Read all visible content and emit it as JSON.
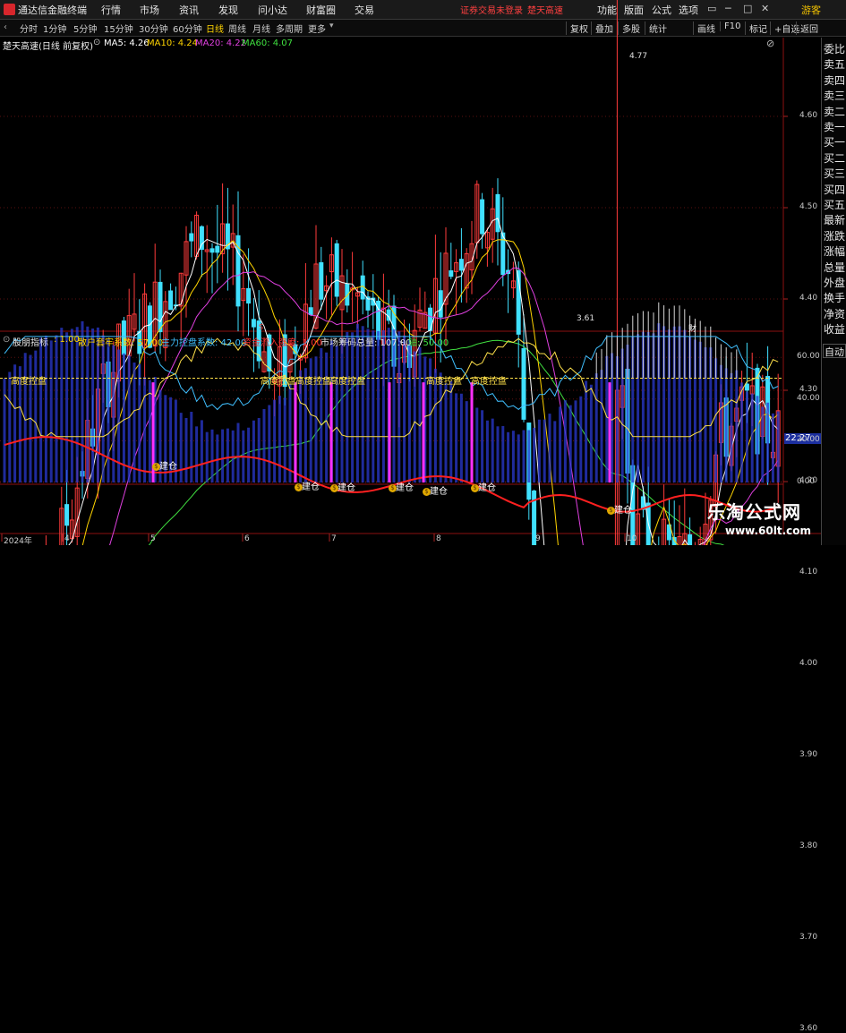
{
  "app": {
    "title": "通达信金融终端",
    "menu": [
      "行情",
      "市场",
      "资讯",
      "发现",
      "问小达",
      "财富圈",
      "交易"
    ],
    "notice_left": "证券交易未登录",
    "notice_right": "楚天高速",
    "right_menu": [
      "功能",
      "版面",
      "公式",
      "选项"
    ],
    "user": "游客",
    "window_buttons": [
      "▭",
      "─",
      "□",
      "✕"
    ]
  },
  "toolbar": {
    "timeframes": [
      "分时",
      "1分钟",
      "5分钟",
      "15分钟",
      "30分钟",
      "60分钟",
      "日线",
      "周线",
      "月线",
      "多周期",
      "更多"
    ],
    "active_timeframe": "日线",
    "buttons": [
      "复权",
      "叠加",
      "多股",
      "统计",
      "画线",
      "F10",
      "标记",
      "+自选",
      "返回"
    ]
  },
  "stock": {
    "name": "楚天高速(日线 前复权)",
    "ma": [
      {
        "label": "MA5: 4.26",
        "color": "#ffffff"
      },
      {
        "label": "MA10: 4.24",
        "color": "#ffd400"
      },
      {
        "label": "MA20: 4.22",
        "color": "#e040e0"
      },
      {
        "label": "MA60: 4.07",
        "color": "#40e040"
      }
    ]
  },
  "side_panel": [
    "委比",
    "卖五",
    "卖四",
    "卖三",
    "卖二",
    "卖一",
    "买一",
    "买二",
    "买三",
    "买四",
    "买五",
    "最新",
    "涨跌",
    "涨幅",
    "总量",
    "外盘",
    "换手",
    "净资",
    "收益"
  ],
  "side_auto_button": "自动",
  "price_axis": [
    "4.60",
    "4.50",
    "4.40",
    "4.30",
    "4.20",
    "4.10",
    "4.00",
    "3.90",
    "3.80",
    "3.70",
    "3.60"
  ],
  "price_high_label": "4.77",
  "price_low_label": "3.61",
  "price_markers": [
    {
      "text": "S",
      "color": "#ff3030"
    },
    {
      "text": "财",
      "color": "#ffffff"
    }
  ],
  "indicator": {
    "name": "股朋指标",
    "params": [
      {
        "label": ": 1.00",
        "color": "#ffd400"
      },
      {
        "label": "散户套牢系数: 57.00",
        "color": "#ffd400"
      },
      {
        "label": "主力控盘系数: 42.00",
        "color": "#40c0ff"
      },
      {
        "label": "资金流入强度: 1.00",
        "color": "#ff3030"
      },
      {
        "label": "市场筹码总量: 107.00",
        "color": "#e8e8e8"
      },
      {
        "label": "轴: 50.00",
        "color": "#40e040"
      }
    ],
    "axis": [
      "60.00",
      "40.00",
      "20.00",
      "0.00"
    ],
    "current_value": "22.27",
    "control_label": "高度控盘",
    "build_label": "建仓"
  },
  "dates": [
    "2024年",
    "4",
    "5",
    "6",
    "7",
    "8",
    "9",
    "10"
  ],
  "watermark": {
    "line1": "乐淘公式网",
    "line2": "www.60lt.com"
  },
  "colors": {
    "up": "#ff3b3b",
    "down": "#40e0ff",
    "ma5": "#ffffff",
    "ma10": "#ffd400",
    "ma20": "#e040e0",
    "ma60": "#40e040",
    "grid": "#8b1010",
    "pink_bar": "#ff30ff"
  }
}
